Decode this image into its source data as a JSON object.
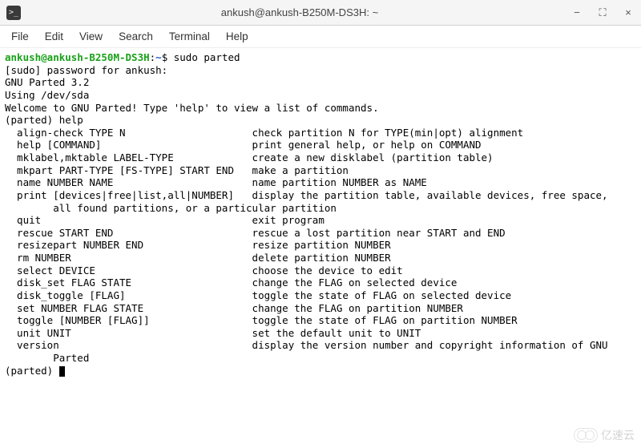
{
  "titlebar": {
    "icon_glyph": ">_",
    "title": "ankush@ankush-B250M-DS3H: ~"
  },
  "window_controls": {
    "minimize": "−",
    "maximize": "⛶",
    "close": "×"
  },
  "menubar": [
    "File",
    "Edit",
    "View",
    "Search",
    "Terminal",
    "Help"
  ],
  "prompt": {
    "user_host": "ankush@ankush-B250M-DS3H",
    "sep": ":",
    "path": "~",
    "symbol": "$",
    "command": "sudo parted"
  },
  "lines_pre_prompt": [
    "[sudo] password for ankush:",
    "GNU Parted 3.2",
    "Using /dev/sda",
    "Welcome to GNU Parted! Type 'help' to view a list of commands.",
    "(parted) help"
  ],
  "help_entries": [
    {
      "cmd": "align-check TYPE N",
      "desc": "check partition N for TYPE(min|opt) alignment"
    },
    {
      "cmd": "help [COMMAND]",
      "desc": "print general help, or help on COMMAND"
    },
    {
      "cmd": "mklabel,mktable LABEL-TYPE",
      "desc": "create a new disklabel (partition table)"
    },
    {
      "cmd": "mkpart PART-TYPE [FS-TYPE] START END",
      "desc": "make a partition"
    },
    {
      "cmd": "name NUMBER NAME",
      "desc": "name partition NUMBER as NAME"
    },
    {
      "cmd": "print [devices|free|list,all|NUMBER]",
      "desc": "display the partition table, available devices, free space,",
      "wrap": "all found partitions, or a particular partition"
    },
    {
      "cmd": "quit",
      "desc": "exit program"
    },
    {
      "cmd": "rescue START END",
      "desc": "rescue a lost partition near START and END"
    },
    {
      "cmd": "resizepart NUMBER END",
      "desc": "resize partition NUMBER"
    },
    {
      "cmd": "rm NUMBER",
      "desc": "delete partition NUMBER"
    },
    {
      "cmd": "select DEVICE",
      "desc": "choose the device to edit"
    },
    {
      "cmd": "disk_set FLAG STATE",
      "desc": "change the FLAG on selected device"
    },
    {
      "cmd": "disk_toggle [FLAG]",
      "desc": "toggle the state of FLAG on selected device"
    },
    {
      "cmd": "set NUMBER FLAG STATE",
      "desc": "change the FLAG on partition NUMBER"
    },
    {
      "cmd": "toggle [NUMBER [FLAG]]",
      "desc": "toggle the state of FLAG on partition NUMBER"
    },
    {
      "cmd": "unit UNIT",
      "desc": "set the default unit to UNIT"
    },
    {
      "cmd": "version",
      "desc": "display the version number and copyright information of GNU",
      "wrap": "Parted"
    }
  ],
  "final_prompt": "(parted) ",
  "watermark": "亿速云",
  "layout": {
    "cmd_indent": "  ",
    "desc_col": 41,
    "wrap_indent": "        "
  }
}
